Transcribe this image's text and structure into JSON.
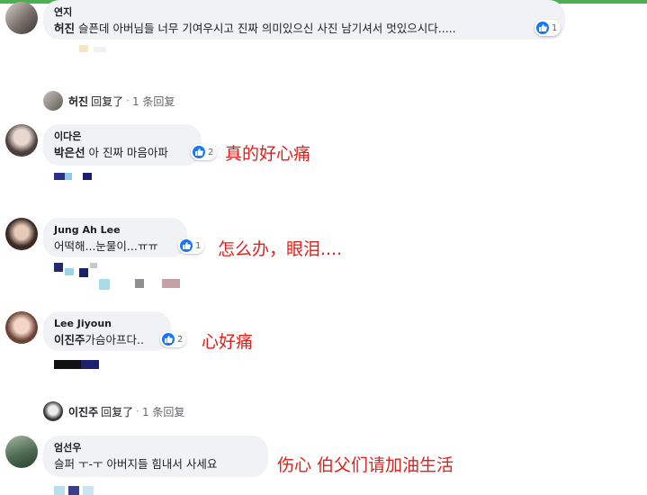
{
  "comments": [
    {
      "name": "연지",
      "tag": "허진",
      "text": " 슬픈데 아버님들 너무 기여우시고 진짜 의미있으신 사진 남기셔서 멋있으시다.....",
      "likes": "1"
    },
    {
      "name": "이다은",
      "tag": "박은선",
      "text": " 아 진짜 마음아파",
      "likes": "2",
      "annotation": "真的好心痛"
    },
    {
      "name": "Jung Ah Lee",
      "tag": "",
      "text": "어떡해...눈물이...ㅠㅠ",
      "likes": "1",
      "annotation": "怎么办，眼泪...."
    },
    {
      "name": "Lee Jiyoun",
      "tag": "이진주",
      "text": "가슴아프다..",
      "likes": "2",
      "annotation": "心好痛"
    },
    {
      "name": "엄선우",
      "tag": "",
      "text": "슬퍼 ㅜ-ㅜ 아버지들 힘내서 사세요",
      "annotation": "伤心 伯父们请加油生活"
    }
  ],
  "replies": [
    {
      "name": "허진",
      "verb": "回复了",
      "sep": "·",
      "count": "1 条回复"
    },
    {
      "name": "이진주",
      "verb": "回复了",
      "sep": "·",
      "count": "1 条回复"
    }
  ],
  "colors": {
    "accent": "#1877f2",
    "annotation": "#e0201a",
    "bubble": "#f0f2f5",
    "topbar": "#4caf50"
  }
}
